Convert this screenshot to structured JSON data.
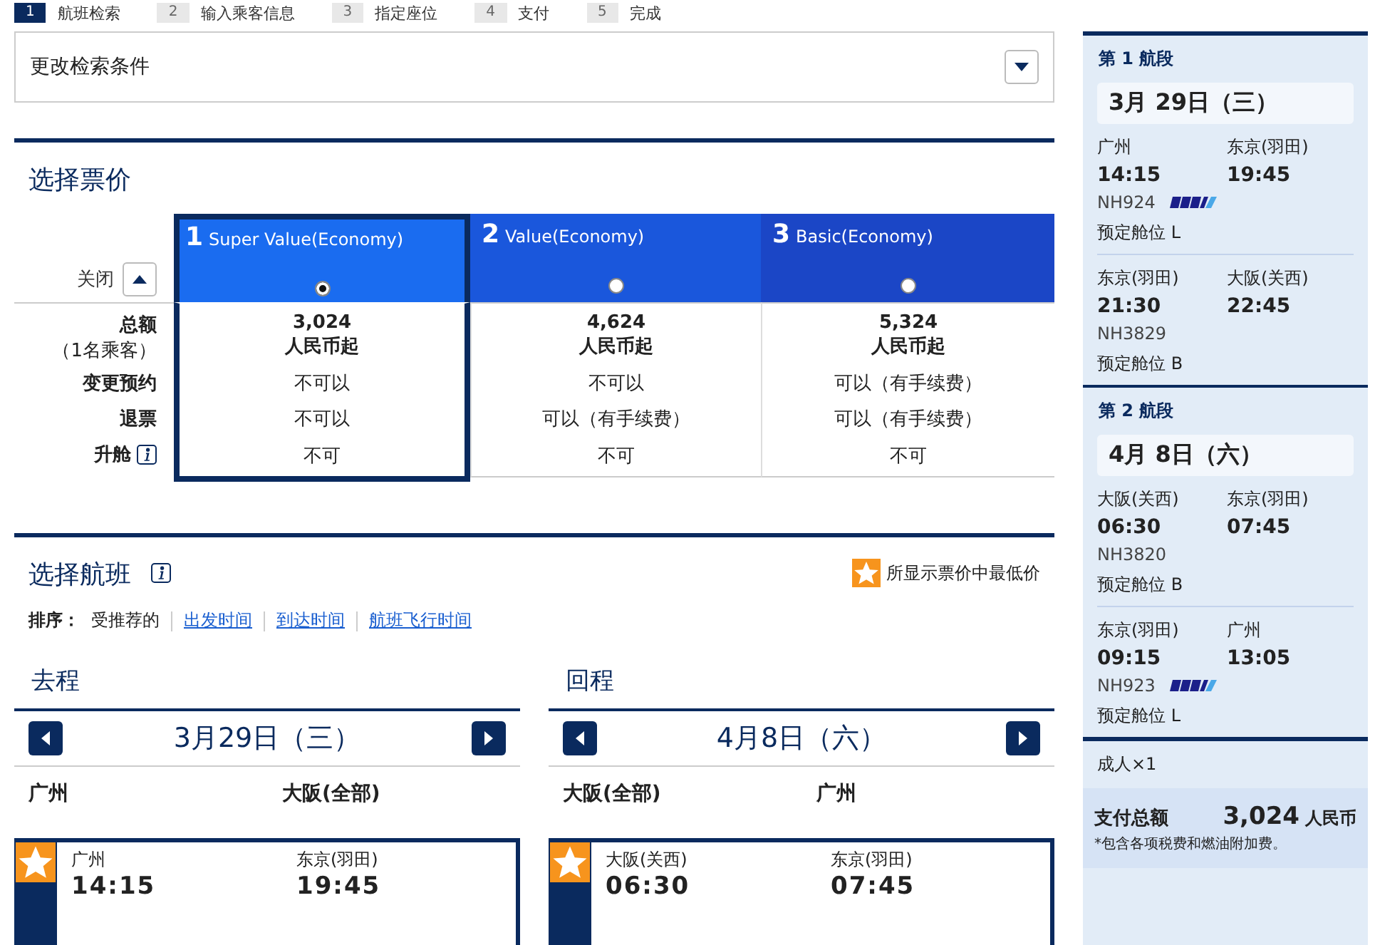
{
  "steps": [
    {
      "number": "1",
      "label": "航班检索",
      "selected": true
    },
    {
      "number": "2",
      "label": "输入乘客信息",
      "selected": false
    },
    {
      "number": "3",
      "label": "指定座位",
      "selected": false
    },
    {
      "number": "4",
      "label": "支付",
      "selected": false
    },
    {
      "number": "5",
      "label": "完成",
      "selected": false
    }
  ],
  "search_panel": {
    "title": "更改检索条件"
  },
  "fare_section": {
    "title": "选择票价",
    "collapse_label": "关闭",
    "row_labels": [
      {
        "label": "总额",
        "sublabel": "（1名乘客）",
        "info": false
      },
      {
        "label": "变更预约",
        "info": false
      },
      {
        "label": "退票",
        "info": false
      },
      {
        "label": "升舱",
        "info": true
      }
    ],
    "fares": [
      {
        "number": "1",
        "name": "Super Value(Economy)",
        "selected": true,
        "total": "3,024",
        "unit": "人民币起",
        "change": "不可以",
        "refund": "不可以",
        "upgrade": "不可"
      },
      {
        "number": "2",
        "name": "Value(Economy)",
        "selected": false,
        "total": "4,624",
        "unit": "人民币起",
        "change": "不可以",
        "refund": "可以（有手续费）",
        "upgrade": "不可"
      },
      {
        "number": "3",
        "name": "Basic(Economy)",
        "selected": false,
        "total": "5,324",
        "unit": "人民币起",
        "change": "可以（有手续费）",
        "refund": "可以（有手续费）",
        "upgrade": "不可"
      }
    ]
  },
  "flight_section": {
    "title": "选择航班",
    "legend": "所显示票价中最低价",
    "sort_label": "排序：",
    "sort_options": [
      {
        "label": "受推荐的",
        "kind": "text"
      },
      {
        "label": "出发时间",
        "kind": "link"
      },
      {
        "label": "到达时间",
        "kind": "link"
      },
      {
        "label": "航班飞行时间",
        "kind": "link"
      }
    ],
    "directions": [
      {
        "title": "去程",
        "date": "3月29日（三）",
        "from": "广州",
        "to": "大阪(全部)",
        "card": {
          "from": "广州",
          "to": "东京(羽田)",
          "dep": "14:15",
          "arr": "19:45"
        }
      },
      {
        "title": "回程",
        "date": "4月8日（六）",
        "from": "大阪(全部)",
        "to": "广州",
        "card": {
          "from": "大阪(关西)",
          "to": "东京(羽田)",
          "dep": "06:30",
          "arr": "07:45"
        }
      }
    ]
  },
  "sidebar": {
    "segments": [
      {
        "title": "第 1 航段",
        "date": "3月 29日（三）",
        "flights": [
          {
            "from": "广州",
            "to": "东京(羽田)",
            "dep": "14:15",
            "arr": "19:45",
            "flight": "NH924",
            "airline_logo": true,
            "cabin": "预定舱位 L"
          },
          {
            "from": "东京(羽田)",
            "to": "大阪(关西)",
            "dep": "21:30",
            "arr": "22:45",
            "flight": "NH3829",
            "airline_logo": false,
            "cabin": "预定舱位 B"
          }
        ]
      },
      {
        "title": "第 2 航段",
        "date": "4月 8日（六）",
        "flights": [
          {
            "from": "大阪(关西)",
            "to": "东京(羽田)",
            "dep": "06:30",
            "arr": "07:45",
            "flight": "NH3820",
            "airline_logo": false,
            "cabin": "预定舱位 B"
          },
          {
            "from": "东京(羽田)",
            "to": "广州",
            "dep": "09:15",
            "arr": "13:05",
            "flight": "NH923",
            "airline_logo": true,
            "cabin": "预定舱位 L"
          }
        ]
      }
    ],
    "passengers": "成人×1",
    "total_label": "支付总额",
    "total_amount": "3,024",
    "total_currency": "人民币",
    "note": "*包含各项税费和燃油附加费。"
  }
}
